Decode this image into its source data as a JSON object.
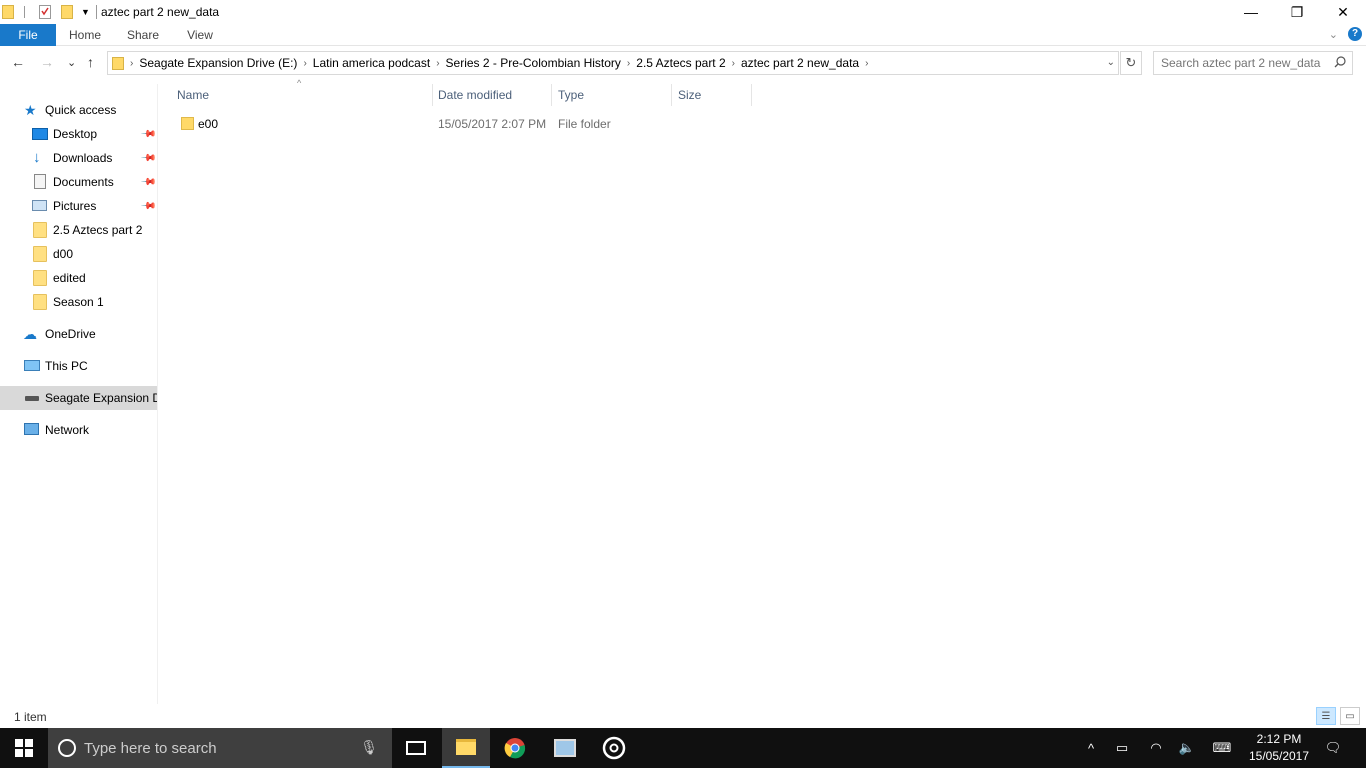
{
  "window": {
    "title": "aztec part 2 new_data",
    "controls": {
      "minimize": "—",
      "restore": "❐",
      "close": "✕"
    }
  },
  "ribbon": {
    "tabs": [
      "File",
      "Home",
      "Share",
      "View"
    ],
    "help": "?"
  },
  "nav": {
    "back": "←",
    "forward": "→",
    "recent": "⌄",
    "up": "↑",
    "breadcrumb": [
      "Seagate Expansion Drive (E:)",
      "Latin america podcast",
      "Series 2 - Pre-Colombian History",
      "2.5 Aztecs part 2",
      "aztec part 2 new_data"
    ],
    "search_placeholder": "Search aztec part 2 new_data"
  },
  "sidebar": {
    "quick_access": "Quick access",
    "pinned": [
      {
        "label": "Desktop",
        "icon": "desktop-icon"
      },
      {
        "label": "Downloads",
        "icon": "downloads-icon"
      },
      {
        "label": "Documents",
        "icon": "documents-icon"
      },
      {
        "label": "Pictures",
        "icon": "pictures-icon"
      }
    ],
    "recent": [
      "2.5 Aztecs part 2",
      "d00",
      "edited",
      "Season 1"
    ],
    "onedrive": "OneDrive",
    "this_pc": "This PC",
    "drive": "Seagate Expansion Drive (E:)",
    "network": "Network"
  },
  "columns": {
    "name": "Name",
    "date": "Date modified",
    "type": "Type",
    "size": "Size"
  },
  "files": [
    {
      "name": "e00",
      "date": "15/05/2017 2:07 PM",
      "type": "File folder",
      "size": ""
    }
  ],
  "status": {
    "count": "1 item"
  },
  "taskbar": {
    "search_placeholder": "Type here to search",
    "time": "2:12 PM",
    "date": "15/05/2017"
  },
  "colors": {
    "accent": "#1979ca",
    "taskbar": "#101010",
    "selected": "#d9d9d9"
  }
}
